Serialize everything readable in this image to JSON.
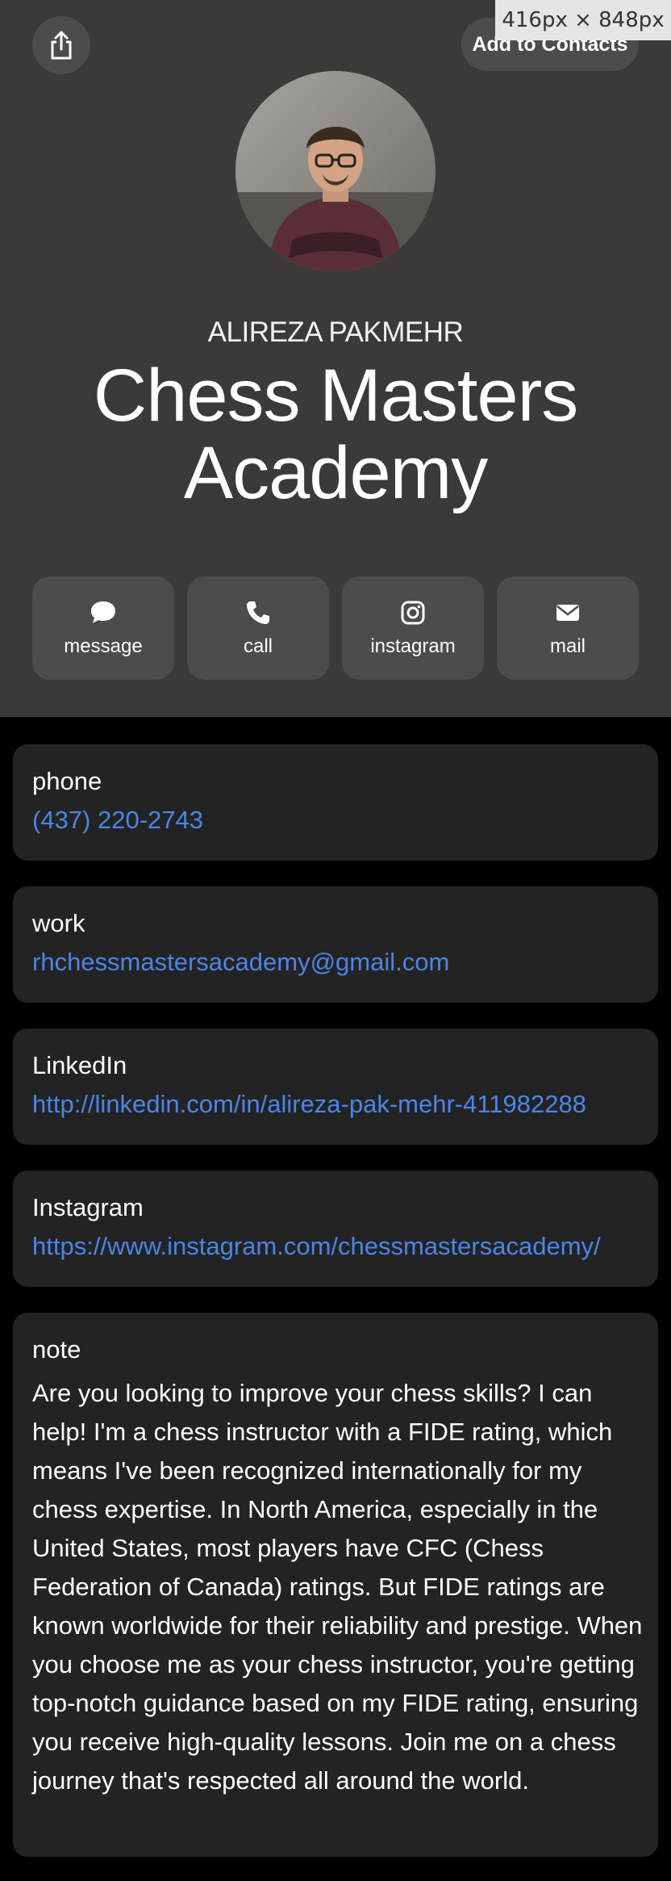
{
  "header": {
    "share_icon": "share-icon",
    "add_to_contacts_label": "Add to Contacts",
    "dimension_badge": "416px × 848px",
    "name": "ALIREZA PAKMEHR",
    "organization": "Chess Masters Academy",
    "background_color": "#3b3a39"
  },
  "actions": [
    {
      "label": "message",
      "icon": "message-bubble-icon"
    },
    {
      "label": "call",
      "icon": "phone-icon"
    },
    {
      "label": "instagram",
      "icon": "instagram-icon"
    },
    {
      "label": "mail",
      "icon": "envelope-icon"
    }
  ],
  "fields": {
    "phone": {
      "label": "phone",
      "value": "(437) 220-2743"
    },
    "work": {
      "label": "work",
      "value": "rhchessmastersacademy@gmail.com"
    },
    "linkedin": {
      "label": "LinkedIn",
      "value": "http://linkedin.com/in/alireza-pak-mehr-411982288"
    },
    "instagram": {
      "label": "Instagram",
      "value": "https://www.instagram.com/chessmastersacademy/"
    },
    "note": {
      "label": "note",
      "value": "Are you looking to improve your chess skills? I can help! I'm a chess instructor with a FIDE rating, which means I've been recognized internationally for my chess expertise. In North America, especially in the United States, most players have CFC (Chess Federation of Canada) ratings. But FIDE ratings are known worldwide for their reliability and prestige. When you choose me as your chess instructor, you're getting top-notch guidance based on my FIDE rating, ensuring you receive high-quality lessons. Join me on a chess journey that's respected all around the world."
    }
  },
  "colors": {
    "link": "#4a86e8",
    "card": "#232323",
    "button": "#4d4c4b"
  }
}
